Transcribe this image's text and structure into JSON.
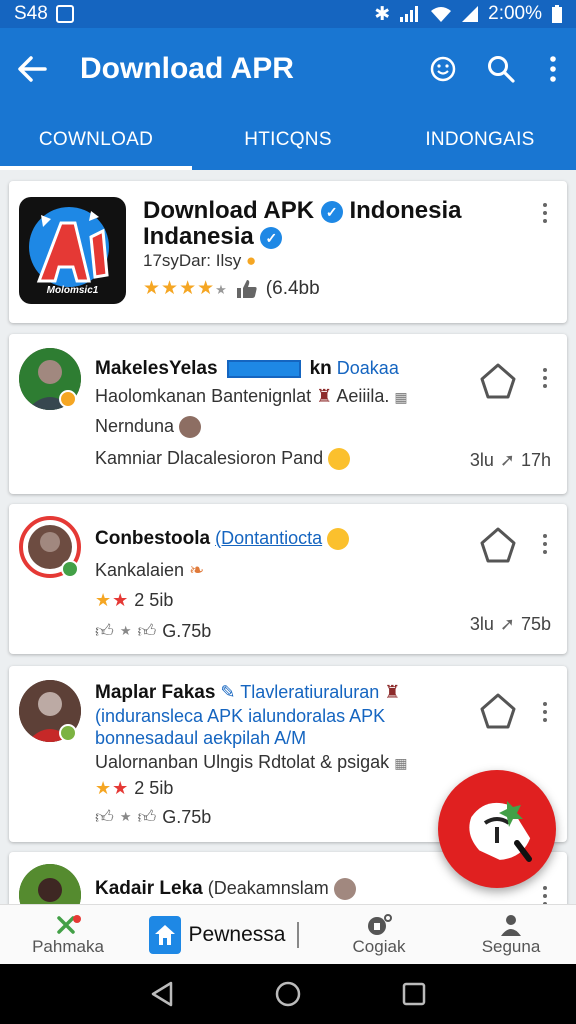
{
  "status_bar": {
    "time": "S48",
    "clock": "2:00%"
  },
  "app_bar": {
    "title": "Download APR"
  },
  "tabs": [
    {
      "label": "COWNLOAD",
      "active": true
    },
    {
      "label": "HTICQNS",
      "active": false
    },
    {
      "label": "INDONGAIS",
      "active": false
    }
  ],
  "app_card": {
    "title_line1": "Download APK",
    "title_line1_tail": "Indonesia",
    "title_line2": "Indanesia",
    "subtitle": "17syDar: Ilsy",
    "rating_stars": 4,
    "size": "(6.4bb",
    "icon_label": "Molomsic1"
  },
  "posts": [
    {
      "name": "MakelesYelas",
      "name_tail": "kn",
      "link": "Doakaa",
      "line1": "Haolomkanan Bantenignlat",
      "line1_tail": "Aeiiila.",
      "line2": "Nernduna",
      "line3": "Kamniar Dlacalesioron Pand",
      "meta_left": "3lu",
      "meta_right": "17h"
    },
    {
      "name": "Conbestoola",
      "link": "(Dontantiocta",
      "line1": "Kankalaien",
      "rating": "2 5ib",
      "size": "G.75b",
      "meta_left": "3lu",
      "meta_right": "75b"
    },
    {
      "name": "Maplar Fakas",
      "link": "Tlavleratiuraluran",
      "line1": "(induransleca APK ialundoralas APK",
      "line2": "bonnesadaul aekpilah A/M",
      "line3": "Ualornanban Ulngis Rdtolat & psigak",
      "rating": "2 5ib",
      "size": "G.75b"
    },
    {
      "name": "Kadair Leka",
      "link": "(Deakamnslam"
    }
  ],
  "bottom_nav": [
    {
      "label": "Pahmaka"
    },
    {
      "label": "Pewnessa"
    },
    {
      "label": "Cogiak"
    },
    {
      "label": "Seguna"
    }
  ],
  "colors": {
    "primary": "#1976d2",
    "status": "#1565c0",
    "fab": "#e02020",
    "star": "#f5a623",
    "link": "#1565c0"
  }
}
